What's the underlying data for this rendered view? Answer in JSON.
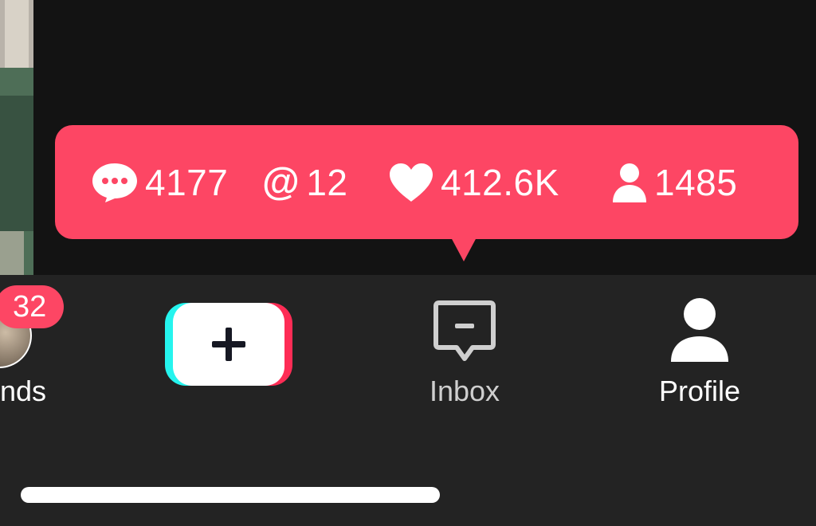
{
  "stats_tooltip": {
    "comments": "4177",
    "mentions_symbol": "@",
    "mentions": "12",
    "likes": "412.6K",
    "followers": "1485",
    "accent_color": "#fd4664",
    "icons": [
      "comment-bubble-icon",
      "at-sign-icon",
      "heart-icon",
      "person-icon"
    ]
  },
  "bottom_nav": {
    "friends_badge": "32",
    "friends_label": "nds",
    "create_icon": "plus-icon",
    "inbox_label": "Inbox",
    "inbox_icon": "inbox-message-icon",
    "profile_label": "Profile",
    "profile_icon": "person-icon"
  }
}
